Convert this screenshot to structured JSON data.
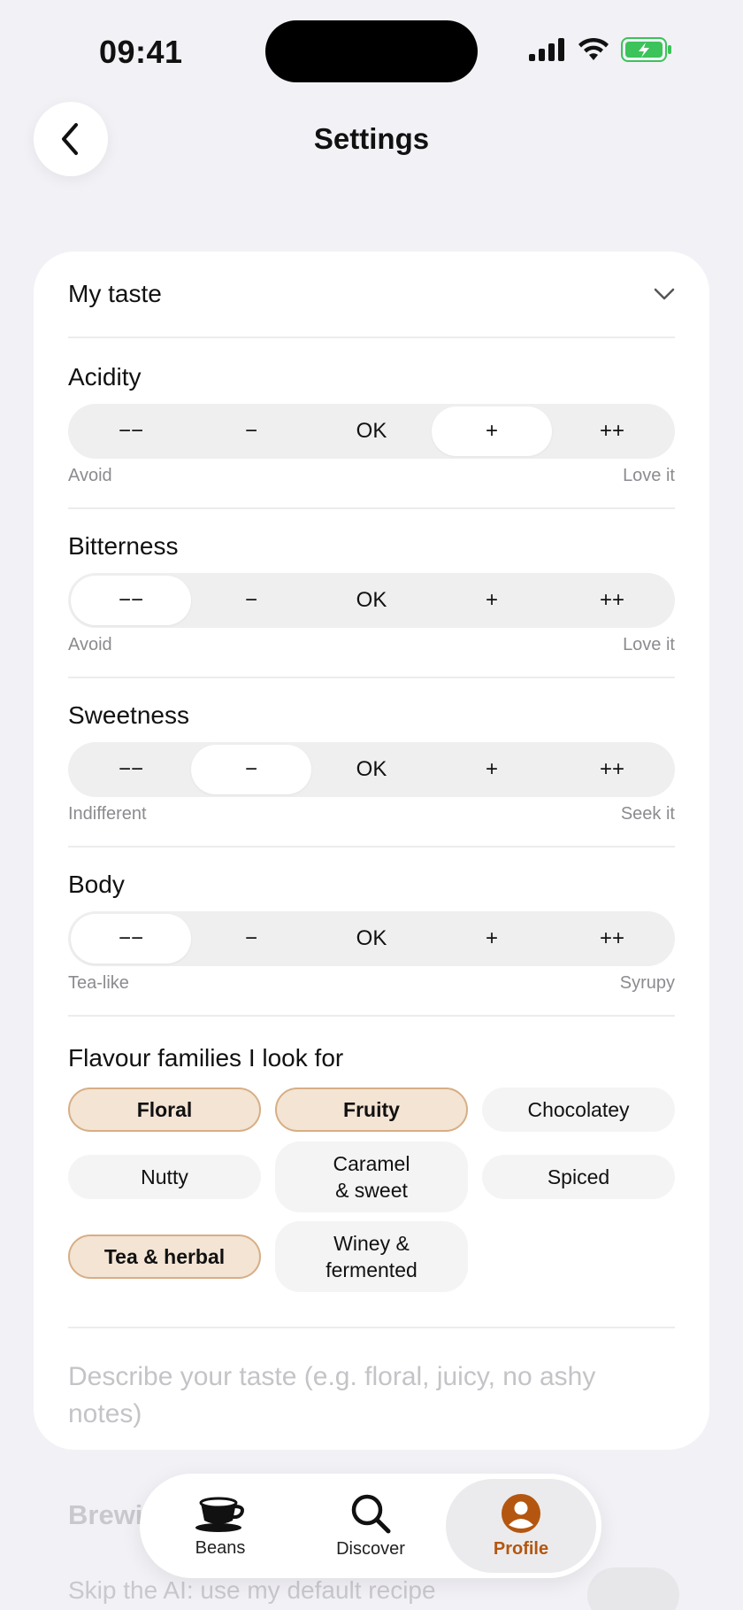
{
  "status_bar": {
    "time": "09:41"
  },
  "header": {
    "title": "Settings"
  },
  "taste_section": {
    "label": "My taste",
    "preferences": [
      {
        "title": "Acidity",
        "options": [
          "−−",
          "−",
          "OK",
          "+",
          "++"
        ],
        "selected": 3,
        "low_hint": "Avoid",
        "high_hint": "Love it"
      },
      {
        "title": "Bitterness",
        "options": [
          "−−",
          "−",
          "OK",
          "+",
          "++"
        ],
        "selected": 0,
        "low_hint": "Avoid",
        "high_hint": "Love it"
      },
      {
        "title": "Sweetness",
        "options": [
          "−−",
          "−",
          "OK",
          "+",
          "++"
        ],
        "selected": 1,
        "low_hint": "Indifferent",
        "high_hint": "Seek it"
      },
      {
        "title": "Body",
        "options": [
          "−−",
          "−",
          "OK",
          "+",
          "++"
        ],
        "selected": 0,
        "low_hint": "Tea-like",
        "high_hint": "Syrupy"
      }
    ],
    "flavour_title": "Flavour families I look for",
    "flavours": [
      {
        "label": "Floral",
        "selected": true
      },
      {
        "label": "Fruity",
        "selected": true
      },
      {
        "label": "Chocolatey",
        "selected": false
      },
      {
        "label": "Nutty",
        "selected": false
      },
      {
        "label": "Caramel\n& sweet",
        "selected": false
      },
      {
        "label": "Spiced",
        "selected": false
      },
      {
        "label": "Tea & herbal",
        "selected": true
      },
      {
        "label": "Winey &\nfermented",
        "selected": false
      }
    ],
    "describe_placeholder": "Describe your taste (e.g. floral, juicy, no ashy notes)"
  },
  "behind": {
    "section_title": "Brewi",
    "row_label": "Skip the AI: use my default recipe"
  },
  "tabbar": {
    "tabs": [
      {
        "label": "Beans",
        "icon": "coffee-cup-icon",
        "active": false
      },
      {
        "label": "Discover",
        "icon": "search-icon",
        "active": false
      },
      {
        "label": "Profile",
        "icon": "profile-icon",
        "active": true
      }
    ]
  },
  "colors": {
    "accent": "#b4560f",
    "chip_selected_bg": "#f3e4d4",
    "chip_selected_border": "#d7ae85",
    "background": "#f2f1f6"
  }
}
